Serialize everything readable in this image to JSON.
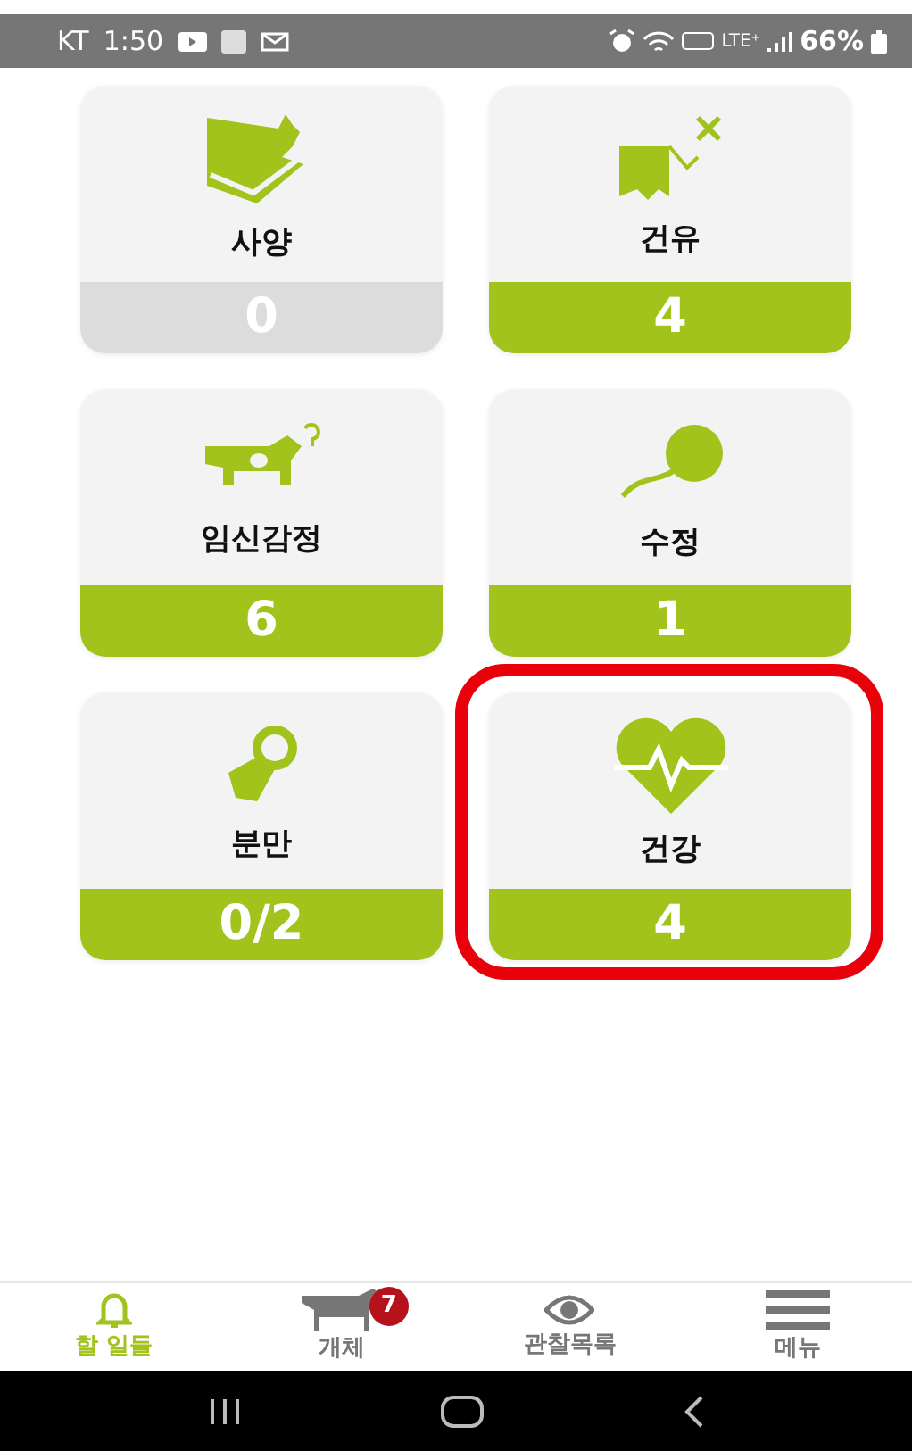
{
  "status_bar": {
    "carrier": "KT",
    "time": "1:50",
    "network": "LTE⁺",
    "battery": "66%"
  },
  "tasks": [
    {
      "kind": "feeding",
      "label": "사양",
      "count": "0",
      "active": false,
      "highlighted": false
    },
    {
      "kind": "drying",
      "label": "건유",
      "count": "4",
      "active": true,
      "highlighted": false
    },
    {
      "kind": "pregnancy",
      "label": "임신감정",
      "count": "6",
      "active": true,
      "highlighted": false
    },
    {
      "kind": "insemination",
      "label": "수정",
      "count": "1",
      "active": true,
      "highlighted": false
    },
    {
      "kind": "calving",
      "label": "분만",
      "count": "0/2",
      "active": true,
      "highlighted": false
    },
    {
      "kind": "health",
      "label": "건강",
      "count": "4",
      "active": true,
      "highlighted": true
    }
  ],
  "bottom_nav": [
    {
      "kind": "bell",
      "label": "할 일들",
      "selected": true
    },
    {
      "kind": "cow",
      "label": "개체",
      "selected": false,
      "badge": "7"
    },
    {
      "kind": "eye",
      "label": "관찰목록",
      "selected": false
    },
    {
      "kind": "menu",
      "label": "메뉴",
      "selected": false
    }
  ]
}
